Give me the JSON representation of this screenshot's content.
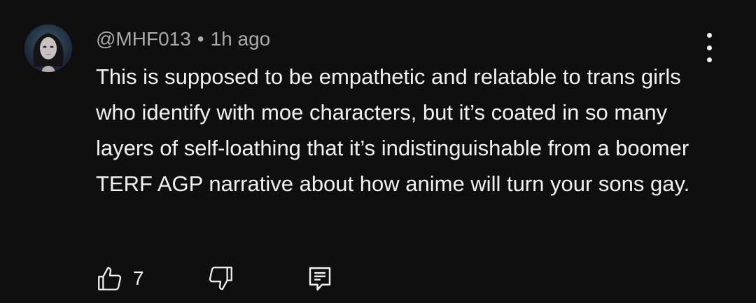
{
  "comment": {
    "handle": "@MHF013",
    "separator": "•",
    "time": "1h ago",
    "text": "This is supposed to be empathetic and relatable to trans girls who identify with moe characters, but it’s coated in so many layers of self-loathing that it’s indistinguishable from a boomer TERF AGP narrative about how anime will turn your sons gay.",
    "like_count": "7",
    "icons": {
      "avatar": "user-avatar",
      "menu": "more-vert-icon",
      "like": "thumbs-up-icon",
      "dislike": "thumbs-down-icon",
      "reply": "reply-comment-icon"
    }
  },
  "colors": {
    "background": "#0f0f0f",
    "primary_text": "#f1f1f1",
    "secondary_text": "#aaaaaa"
  }
}
